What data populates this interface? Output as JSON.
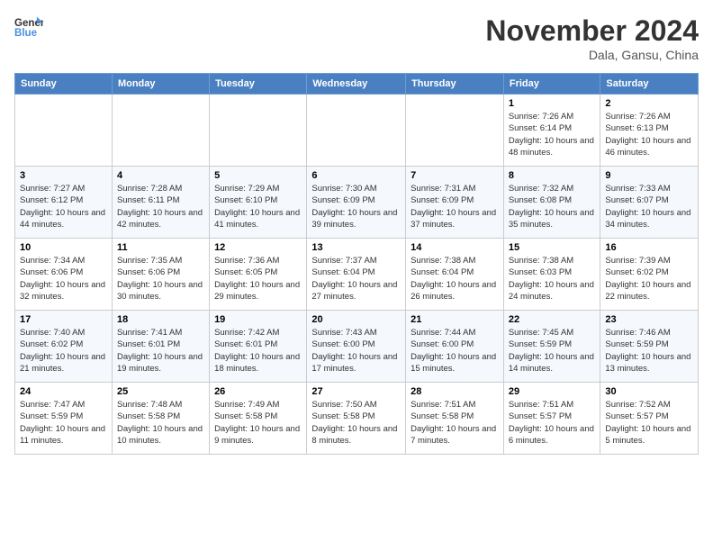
{
  "header": {
    "logo_line1": "General",
    "logo_line2": "Blue",
    "month": "November 2024",
    "location": "Dala, Gansu, China"
  },
  "weekdays": [
    "Sunday",
    "Monday",
    "Tuesday",
    "Wednesday",
    "Thursday",
    "Friday",
    "Saturday"
  ],
  "weeks": [
    [
      {
        "day": "",
        "info": ""
      },
      {
        "day": "",
        "info": ""
      },
      {
        "day": "",
        "info": ""
      },
      {
        "day": "",
        "info": ""
      },
      {
        "day": "",
        "info": ""
      },
      {
        "day": "1",
        "info": "Sunrise: 7:26 AM\nSunset: 6:14 PM\nDaylight: 10 hours and 48 minutes."
      },
      {
        "day": "2",
        "info": "Sunrise: 7:26 AM\nSunset: 6:13 PM\nDaylight: 10 hours and 46 minutes."
      }
    ],
    [
      {
        "day": "3",
        "info": "Sunrise: 7:27 AM\nSunset: 6:12 PM\nDaylight: 10 hours and 44 minutes."
      },
      {
        "day": "4",
        "info": "Sunrise: 7:28 AM\nSunset: 6:11 PM\nDaylight: 10 hours and 42 minutes."
      },
      {
        "day": "5",
        "info": "Sunrise: 7:29 AM\nSunset: 6:10 PM\nDaylight: 10 hours and 41 minutes."
      },
      {
        "day": "6",
        "info": "Sunrise: 7:30 AM\nSunset: 6:09 PM\nDaylight: 10 hours and 39 minutes."
      },
      {
        "day": "7",
        "info": "Sunrise: 7:31 AM\nSunset: 6:09 PM\nDaylight: 10 hours and 37 minutes."
      },
      {
        "day": "8",
        "info": "Sunrise: 7:32 AM\nSunset: 6:08 PM\nDaylight: 10 hours and 35 minutes."
      },
      {
        "day": "9",
        "info": "Sunrise: 7:33 AM\nSunset: 6:07 PM\nDaylight: 10 hours and 34 minutes."
      }
    ],
    [
      {
        "day": "10",
        "info": "Sunrise: 7:34 AM\nSunset: 6:06 PM\nDaylight: 10 hours and 32 minutes."
      },
      {
        "day": "11",
        "info": "Sunrise: 7:35 AM\nSunset: 6:06 PM\nDaylight: 10 hours and 30 minutes."
      },
      {
        "day": "12",
        "info": "Sunrise: 7:36 AM\nSunset: 6:05 PM\nDaylight: 10 hours and 29 minutes."
      },
      {
        "day": "13",
        "info": "Sunrise: 7:37 AM\nSunset: 6:04 PM\nDaylight: 10 hours and 27 minutes."
      },
      {
        "day": "14",
        "info": "Sunrise: 7:38 AM\nSunset: 6:04 PM\nDaylight: 10 hours and 26 minutes."
      },
      {
        "day": "15",
        "info": "Sunrise: 7:38 AM\nSunset: 6:03 PM\nDaylight: 10 hours and 24 minutes."
      },
      {
        "day": "16",
        "info": "Sunrise: 7:39 AM\nSunset: 6:02 PM\nDaylight: 10 hours and 22 minutes."
      }
    ],
    [
      {
        "day": "17",
        "info": "Sunrise: 7:40 AM\nSunset: 6:02 PM\nDaylight: 10 hours and 21 minutes."
      },
      {
        "day": "18",
        "info": "Sunrise: 7:41 AM\nSunset: 6:01 PM\nDaylight: 10 hours and 19 minutes."
      },
      {
        "day": "19",
        "info": "Sunrise: 7:42 AM\nSunset: 6:01 PM\nDaylight: 10 hours and 18 minutes."
      },
      {
        "day": "20",
        "info": "Sunrise: 7:43 AM\nSunset: 6:00 PM\nDaylight: 10 hours and 17 minutes."
      },
      {
        "day": "21",
        "info": "Sunrise: 7:44 AM\nSunset: 6:00 PM\nDaylight: 10 hours and 15 minutes."
      },
      {
        "day": "22",
        "info": "Sunrise: 7:45 AM\nSunset: 5:59 PM\nDaylight: 10 hours and 14 minutes."
      },
      {
        "day": "23",
        "info": "Sunrise: 7:46 AM\nSunset: 5:59 PM\nDaylight: 10 hours and 13 minutes."
      }
    ],
    [
      {
        "day": "24",
        "info": "Sunrise: 7:47 AM\nSunset: 5:59 PM\nDaylight: 10 hours and 11 minutes."
      },
      {
        "day": "25",
        "info": "Sunrise: 7:48 AM\nSunset: 5:58 PM\nDaylight: 10 hours and 10 minutes."
      },
      {
        "day": "26",
        "info": "Sunrise: 7:49 AM\nSunset: 5:58 PM\nDaylight: 10 hours and 9 minutes."
      },
      {
        "day": "27",
        "info": "Sunrise: 7:50 AM\nSunset: 5:58 PM\nDaylight: 10 hours and 8 minutes."
      },
      {
        "day": "28",
        "info": "Sunrise: 7:51 AM\nSunset: 5:58 PM\nDaylight: 10 hours and 7 minutes."
      },
      {
        "day": "29",
        "info": "Sunrise: 7:51 AM\nSunset: 5:57 PM\nDaylight: 10 hours and 6 minutes."
      },
      {
        "day": "30",
        "info": "Sunrise: 7:52 AM\nSunset: 5:57 PM\nDaylight: 10 hours and 5 minutes."
      }
    ]
  ]
}
